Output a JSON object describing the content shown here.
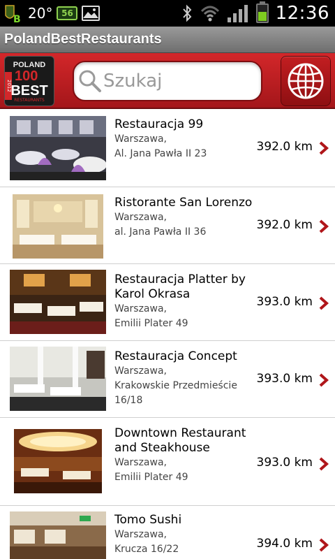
{
  "status_bar": {
    "temperature": "20°",
    "mini_battery": "56",
    "time": "12:36"
  },
  "app": {
    "title": "PolandBestRestaurants"
  },
  "header": {
    "logo": {
      "line1": "POLAND",
      "line2": "100",
      "line3": "BEST",
      "year": "2012",
      "sub": "RESTAURANTS"
    },
    "search": {
      "placeholder": "Szukaj"
    }
  },
  "restaurants": [
    {
      "name": "Restauracja 99",
      "city": "Warszawa,",
      "address": "Al. Jana Pawła II 23",
      "distance": "392.0 km"
    },
    {
      "name": "Ristorante San Lorenzo",
      "city": "Warszawa,",
      "address": "al. Jana Pawła II 36",
      "distance": "392.0 km"
    },
    {
      "name": "Restauracja Platter by Karol Okrasa",
      "city": "Warszawa,",
      "address": "Emilii Plater 49",
      "distance": "393.0 km"
    },
    {
      "name": "Restauracja Concept",
      "city": "Warszawa,",
      "address": "Krakowskie Przedmieście 16/18",
      "distance": "393.0 km"
    },
    {
      "name": "Downtown Restaurant and Steakhouse",
      "city": "Warszawa,",
      "address": "Emilii Plater 49",
      "distance": "393.0 km"
    },
    {
      "name": "Tomo Sushi",
      "city": "Warszawa,",
      "address": "Krucza 16/22",
      "distance": "394.0 km"
    }
  ],
  "colors": {
    "accent_red": "#c21e21",
    "chevron": "#b0161a"
  }
}
